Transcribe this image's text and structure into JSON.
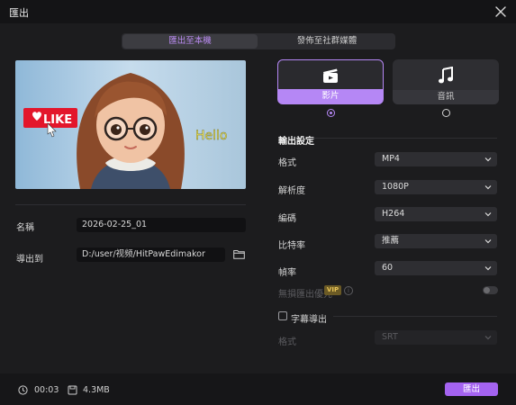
{
  "window": {
    "title": "匯出"
  },
  "tabs": [
    {
      "label": "匯出至本機",
      "active": true
    },
    {
      "label": "發佈至社群媒體",
      "active": false
    }
  ],
  "preview": {
    "badge_text": "LIKE",
    "overlay_text": "Hello"
  },
  "file": {
    "name_label": "名稱",
    "name_value": "2026-02-25_01",
    "export_to_label": "導出到",
    "path_value": "D:/user/视频/HitPawEdimakor"
  },
  "format_tiles": [
    {
      "label": "影片",
      "icon": "film-clapper-icon",
      "selected": true
    },
    {
      "label": "音訊",
      "icon": "music-note-icon",
      "selected": false
    }
  ],
  "settings": {
    "section_title": "輸出設定",
    "rows": [
      {
        "label": "格式",
        "value": "MP4"
      },
      {
        "label": "解析度",
        "value": "1080P"
      },
      {
        "label": "編碼",
        "value": "H264"
      },
      {
        "label": "比特率",
        "value": "推薦"
      },
      {
        "label": "幀率",
        "value": "60"
      }
    ],
    "lossless_label": "無損匯出優先",
    "vip_badge": "VIP",
    "info_glyph": "i",
    "subtitle_label": "字幕導出",
    "subtitle_format_label": "格式",
    "subtitle_format_value": "SRT"
  },
  "footer": {
    "duration": "00:03",
    "size": "4.3MB",
    "export_button": "匯出"
  },
  "colors": {
    "accent": "#b587f5",
    "button": "#a463f0",
    "vip": "#e8c457"
  }
}
